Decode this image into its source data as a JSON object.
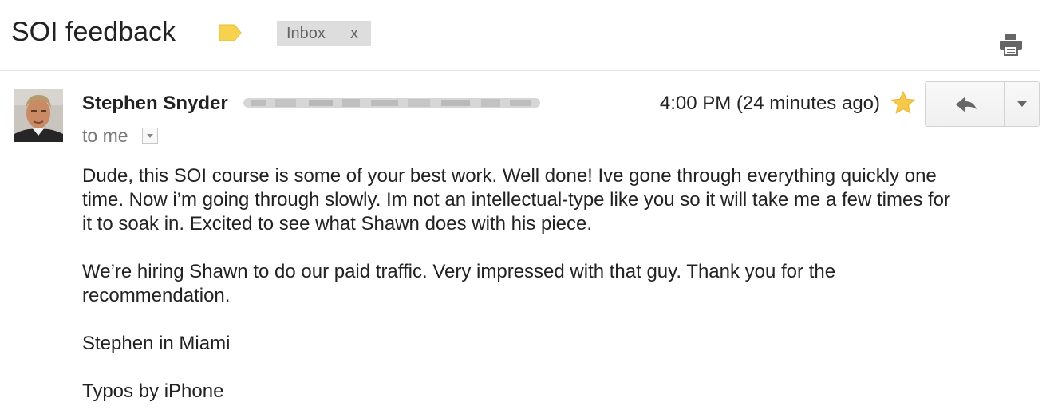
{
  "email": {
    "subject": "SOI feedback",
    "label_chip": "Inbox",
    "label_chip_remove": "x",
    "sender_name": "Stephen Snyder",
    "recipient_line": "to me",
    "timestamp": "4:00 PM (24 minutes ago)",
    "starred": true,
    "body_paragraphs": [
      "Dude, this SOI course is some of your best work. Well done! Ive gone through everything quickly one\ntime. Now i’m going through slowly. Im not an intellectual-type like you so it will take me a few times for\nit to soak in. Excited to see what Shawn does with his piece.",
      "We’re hiring Shawn to do our paid traffic. Very impressed with that guy. Thank you for the\nrecommendation.",
      "Stephen in Miami",
      "Typos by iPhone"
    ]
  },
  "icons": {
    "label": "label-tag-icon",
    "print": "print-icon",
    "star": "star-icon",
    "reply": "reply-icon",
    "more": "chevron-down-icon",
    "details": "chevron-down-icon"
  },
  "colors": {
    "label_tag": "#f6d24f",
    "star": "#f7c948",
    "chip_bg": "#dddddd",
    "icon_gray": "#666666"
  }
}
